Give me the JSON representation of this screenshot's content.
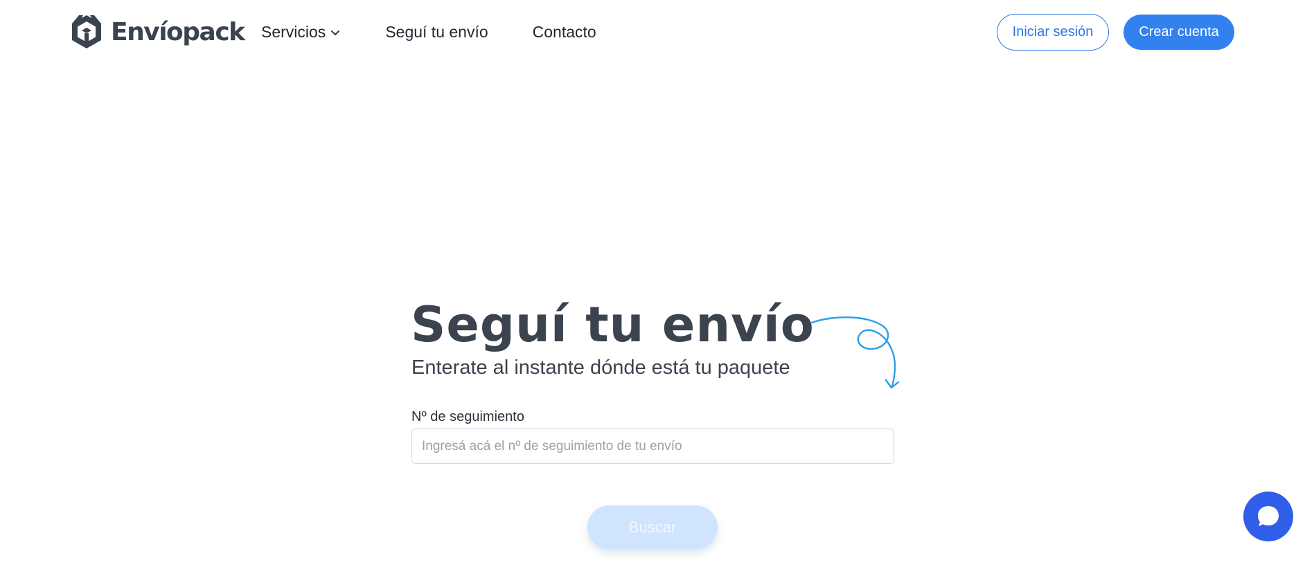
{
  "header": {
    "logo_text": "Envíopack",
    "nav": {
      "services_label": "Servicios",
      "track_label": "Seguí tu envío",
      "contact_label": "Contacto"
    },
    "login_label": "Iniciar sesión",
    "signup_label": "Crear cuenta"
  },
  "main": {
    "title": "Seguí tu envío",
    "subtitle": "Enterate al instante dónde está tu paquete",
    "field_label": "Nº de seguimiento",
    "input_placeholder": "Ingresá acá el nº de seguimiento de tu envío",
    "input_value": "",
    "search_label": "Buscar"
  },
  "icons": {
    "logo": "envopack-logo-icon",
    "services_chevron": "chevron-down-icon",
    "doodle": "curly-arrow-icon",
    "chat": "chat-bubble-icon"
  },
  "colors": {
    "primary": "#3381ef",
    "text": "#3b434e",
    "search_disabled": "#cfe4fd",
    "chat": "#2f5fe8",
    "doodle": "#2a9fe8"
  }
}
